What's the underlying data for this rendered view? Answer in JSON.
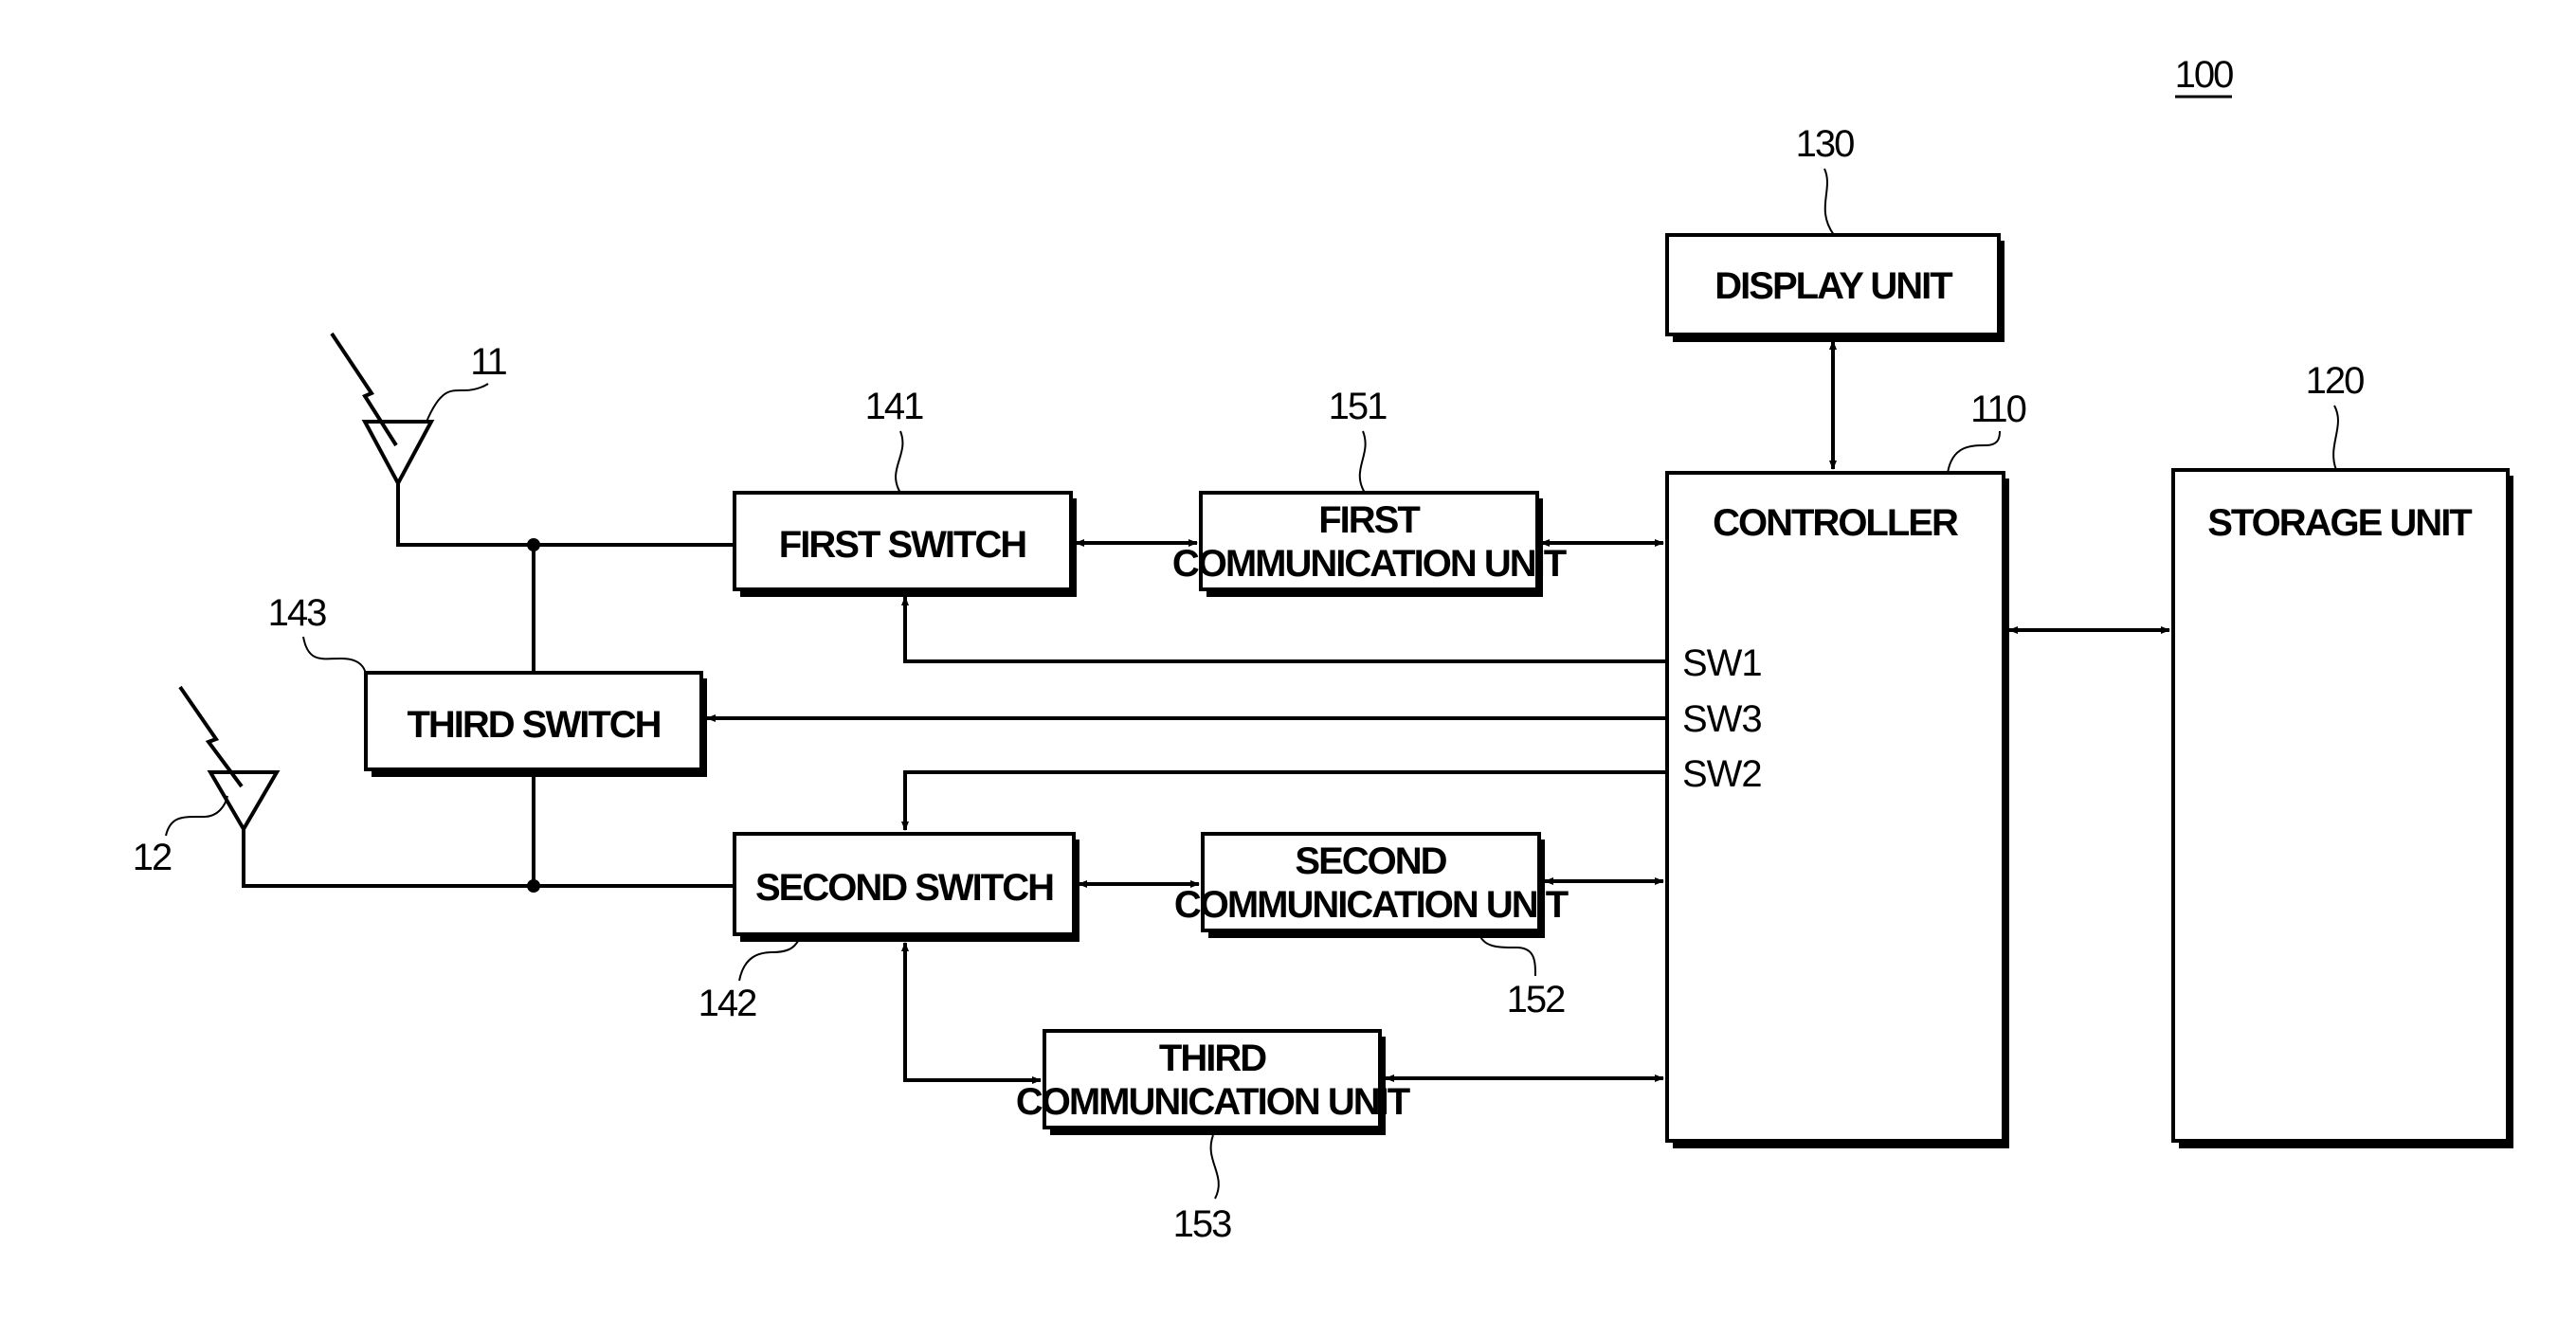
{
  "figure_ref": "100",
  "blocks": {
    "display_unit": {
      "label": "DISPLAY UNIT",
      "ref": "130"
    },
    "controller": {
      "label": "CONTROLLER",
      "ref": "110",
      "signals": [
        "SW1",
        "SW3",
        "SW2"
      ]
    },
    "storage_unit": {
      "label": "STORAGE UNIT",
      "ref": "120"
    },
    "first_switch": {
      "label": "FIRST SWITCH",
      "ref": "141"
    },
    "second_switch": {
      "label": "SECOND SWITCH",
      "ref": "142"
    },
    "third_switch": {
      "label": "THIRD SWITCH",
      "ref": "143"
    },
    "first_comm": {
      "label_line1": "FIRST",
      "label_line2": "COMMUNICATION UNIT",
      "ref": "151"
    },
    "second_comm": {
      "label_line1": "SECOND",
      "label_line2": "COMMUNICATION UNIT",
      "ref": "152"
    },
    "third_comm": {
      "label_line1": "THIRD",
      "label_line2": "COMMUNICATION UNIT",
      "ref": "153"
    }
  },
  "antennas": [
    {
      "ref": "11"
    },
    {
      "ref": "12"
    }
  ]
}
